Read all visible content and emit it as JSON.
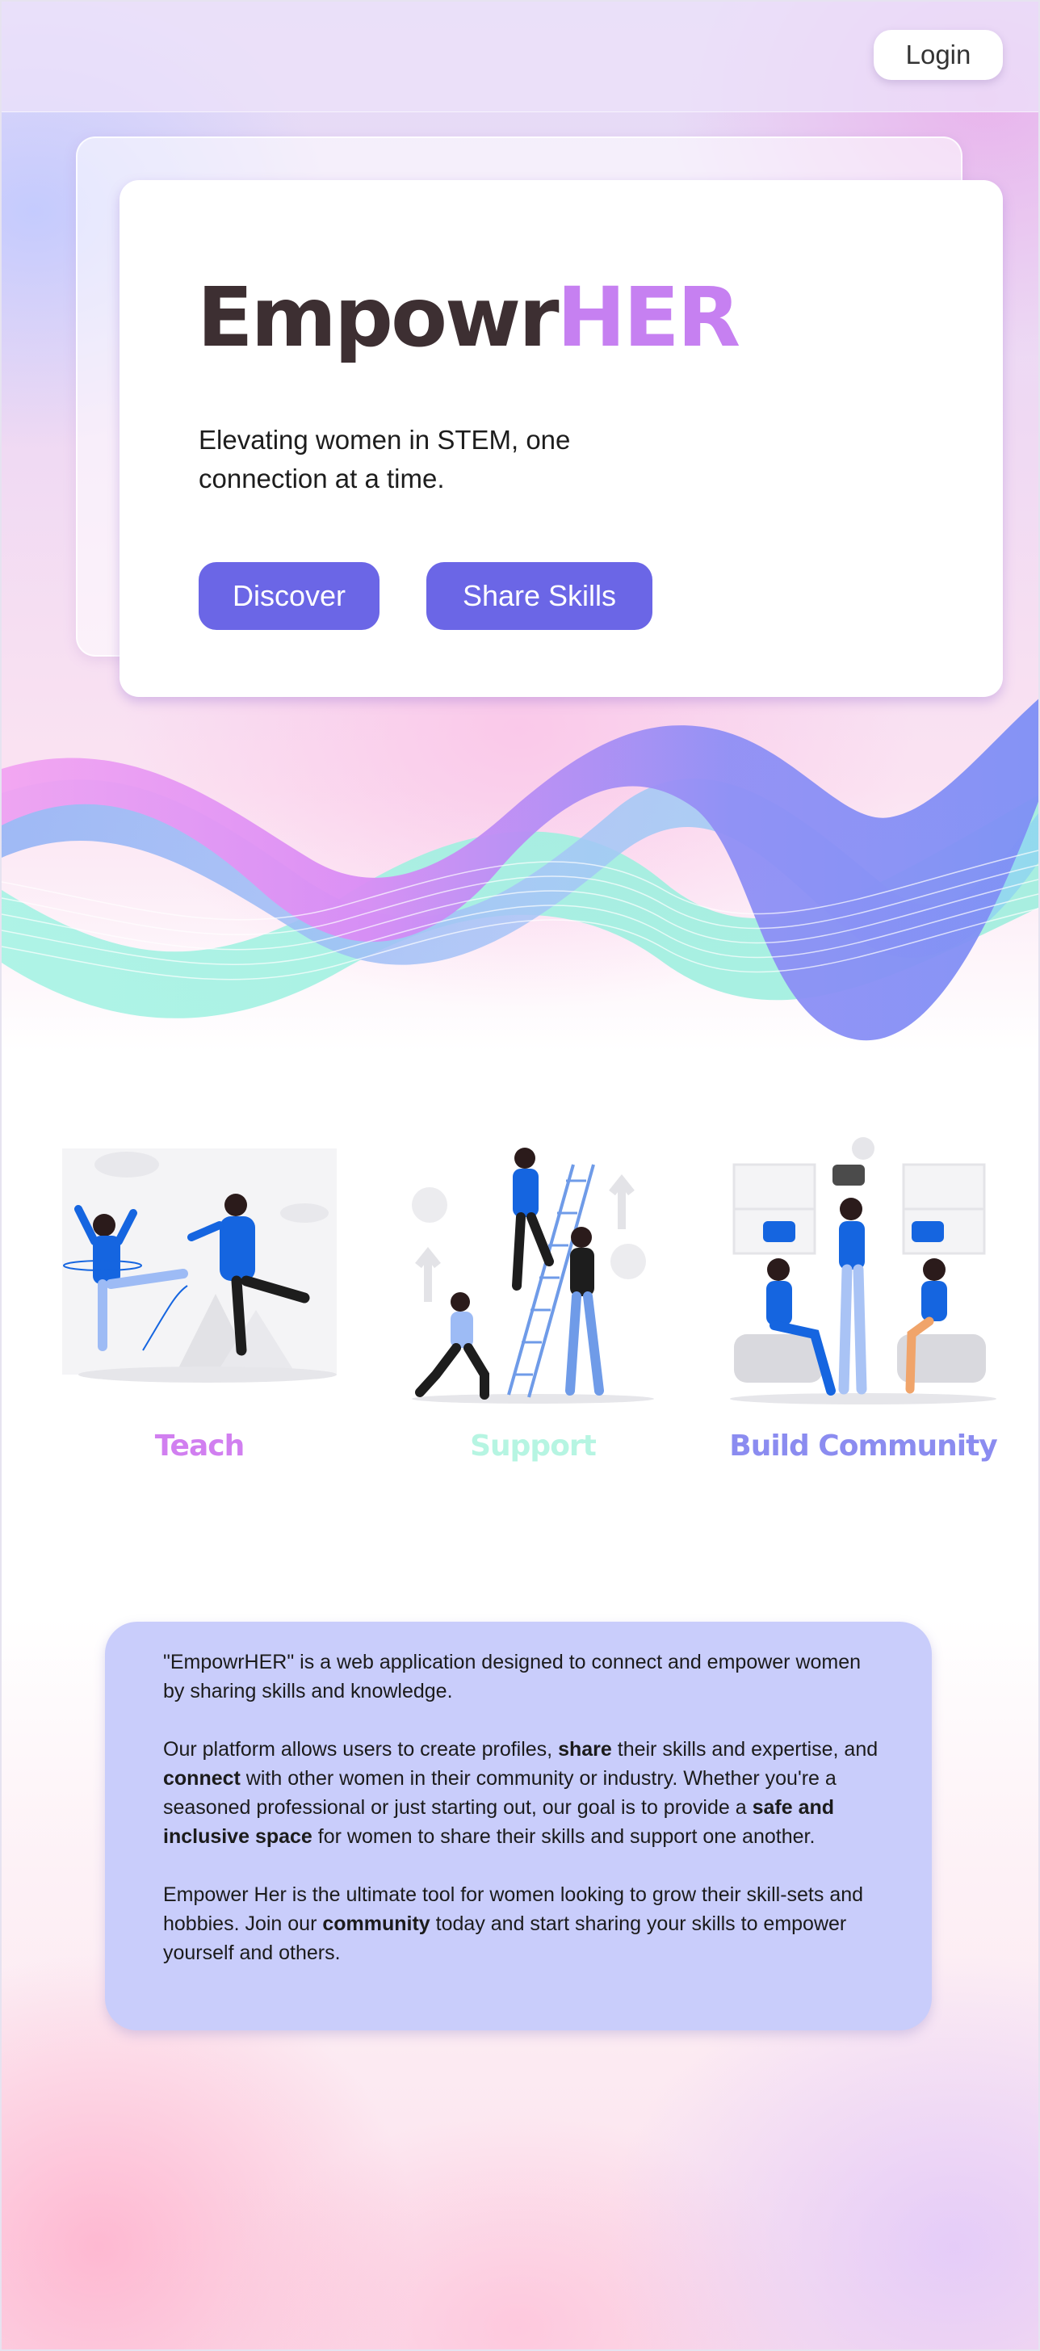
{
  "header": {
    "login_label": "Login"
  },
  "hero": {
    "brand_part1": "Empowr",
    "brand_part2": "HER",
    "tagline": "Elevating women in STEM, one connection at a time.",
    "discover_label": "Discover",
    "share_label": "Share Skills"
  },
  "features": [
    {
      "label": "Teach",
      "color": "#d17ff0",
      "illustration": "ice-skaters-illustration"
    },
    {
      "label": "Support",
      "color": "#b6f5e2",
      "illustration": "ladder-helpers-illustration"
    },
    {
      "label": "Build Community",
      "color": "#8b8cf0",
      "illustration": "group-conversation-illustration"
    }
  ],
  "about": {
    "p1": "\"EmpowrHER\" is a web application designed to connect and empower women by sharing skills and knowledge.",
    "p2_a": "Our platform allows users to create profiles, ",
    "p2_b": "share",
    "p2_c": " their skills and expertise, and ",
    "p2_d": "connect",
    "p2_e": " with other women in their community or industry. Whether you're a seasoned professional or just starting out, our goal is to provide a ",
    "p2_f": "safe and inclusive space",
    "p2_g": " for women to share their skills and support one another.",
    "p3_a": "Empower Her is the ultimate tool for women looking to grow their skill-sets and hobbies. Join our ",
    "p3_b": "community",
    "p3_c": " today and start sharing your skills to empower yourself and others."
  },
  "colors": {
    "accent": "#6b66e6",
    "brand_dark": "#3d2f32",
    "brand_pink": "#c680f1",
    "about_card": "#c9cdfb"
  }
}
